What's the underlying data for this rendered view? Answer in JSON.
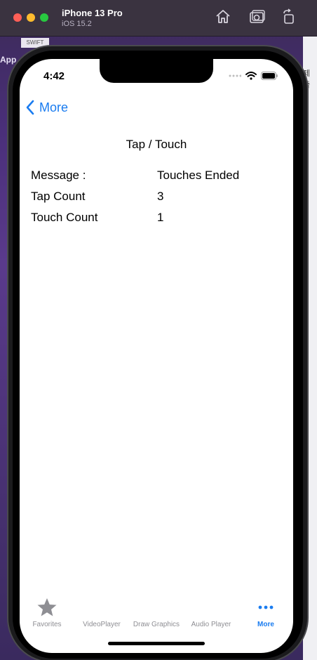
{
  "simulator": {
    "device_name": "iPhone 13 Pro",
    "os_version": "iOS 15.2"
  },
  "background": {
    "swift_tag": "SWIFT",
    "left_fragment": "App",
    "right_fragment": "제출"
  },
  "status_bar": {
    "time": "4:42"
  },
  "nav": {
    "back_label": "More"
  },
  "page": {
    "title": "Tap / Touch",
    "rows": [
      {
        "label": "Message :",
        "value": "Touches Ended"
      },
      {
        "label": "Tap Count",
        "value": "3"
      },
      {
        "label": "Touch Count",
        "value": "1"
      }
    ]
  },
  "tabbar": {
    "tabs": [
      {
        "label": "Favorites",
        "icon": "star-icon"
      },
      {
        "label": "VideoPlayer",
        "icon": ""
      },
      {
        "label": "Draw Graphics",
        "icon": ""
      },
      {
        "label": "Audio Player",
        "icon": ""
      },
      {
        "label": "More",
        "icon": "more-dots-icon"
      }
    ],
    "active_index": 4,
    "active_color": "#1a7cf0",
    "inactive_color": "#8e8e93"
  }
}
